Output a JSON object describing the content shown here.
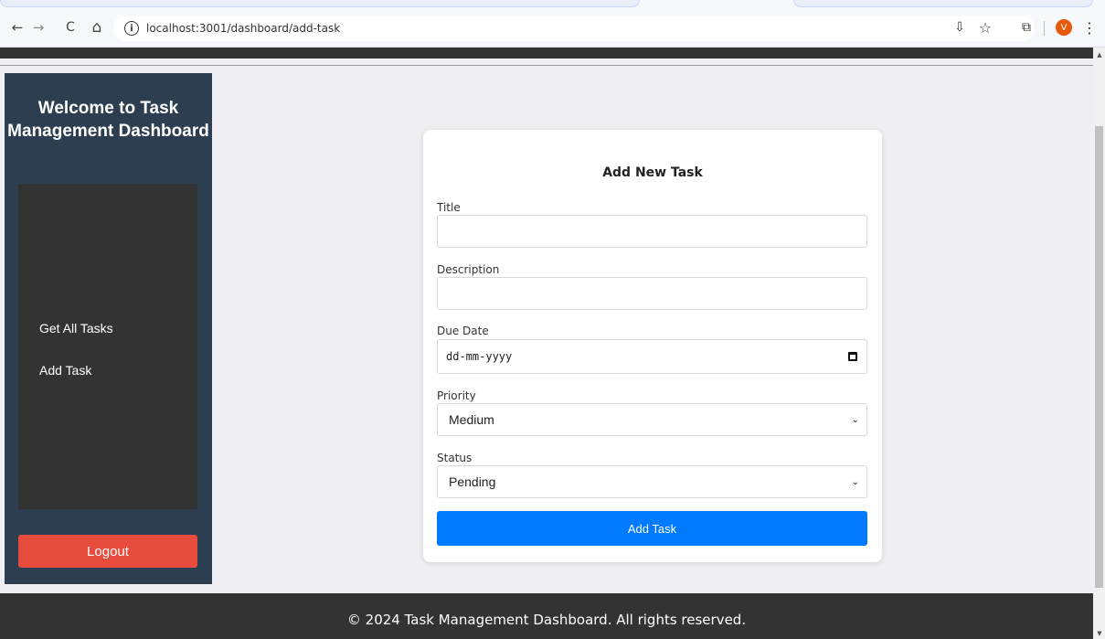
{
  "browser": {
    "url": "localhost:3001/dashboard/add-task",
    "profile_initial": "V",
    "icons": {
      "back": "back-arrow-icon",
      "forward": "forward-arrow-icon",
      "reload": "reload-icon",
      "home": "home-icon",
      "site_info": "info-icon",
      "install": "install-app-icon",
      "bookmark": "star-icon",
      "extensions": "puzzle-icon",
      "menu": "kebab-menu-icon"
    },
    "glyphs": {
      "back": "←",
      "forward": "→",
      "reload": "C",
      "home": "⌂",
      "info": "i",
      "install": "⇩",
      "star": "☆",
      "extensions": "⧉",
      "menu": "⋮"
    }
  },
  "sidebar": {
    "title": "Welcome to Task Management Dashboard",
    "items": [
      {
        "label": "Get All Tasks"
      },
      {
        "label": "Add Task"
      }
    ],
    "logout_label": "Logout"
  },
  "form": {
    "heading": "Add New Task",
    "title_label": "Title",
    "title_value": "",
    "description_label": "Description",
    "description_value": "",
    "due_date_label": "Due Date",
    "due_date_placeholder": "dd-mm-yyyy",
    "priority_label": "Priority",
    "priority_value": "Medium",
    "status_label": "Status",
    "status_value": "Pending",
    "submit_label": "Add Task"
  },
  "footer": {
    "text": "© 2024 Task Management Dashboard. All rights reserved."
  },
  "colors": {
    "sidebar_bg": "#2c3e50",
    "menu_bg": "#333333",
    "logout_bg": "#e74c3c",
    "primary": "#007bff",
    "footer_bg": "#333333",
    "page_bg": "#efeff3"
  }
}
